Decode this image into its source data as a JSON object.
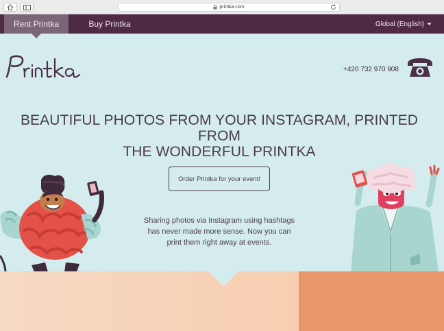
{
  "browser": {
    "url": "printka.com",
    "home_icon": "home-icon",
    "sidebar_icon": "sidebar-icon",
    "lock_icon": "lock-icon",
    "reload_icon": "reload-icon"
  },
  "nav": {
    "items": [
      {
        "label": "Rent Printka",
        "active": true
      },
      {
        "label": "Buy Printka",
        "active": false
      }
    ],
    "language": "Global (English)",
    "language_icon": "caret-down-icon"
  },
  "header": {
    "logo_text": "Printka",
    "phone": "+420 732 970 908",
    "phone_icon": "telephone-icon"
  },
  "hero": {
    "headline_line1": "BEAUTIFUL PHOTOS FROM YOUR INSTAGRAM, PRINTED FROM",
    "headline_line2": "THE WONDERFUL PRINTKA",
    "cta_label": "Order Printka for your event!",
    "description_line1": "Sharing photos via Instagram using hashtags",
    "description_line2": "has never made more sense. Now you can",
    "description_line3": "print them right away at events."
  },
  "colors": {
    "nav_bg": "#4e2a45",
    "nav_active": "#7a6677",
    "hero_bg": "#d4ecee",
    "text": "#4b3a4c",
    "bottom_peach": "#f8cfb1",
    "bottom_orange": "#e9976a"
  }
}
